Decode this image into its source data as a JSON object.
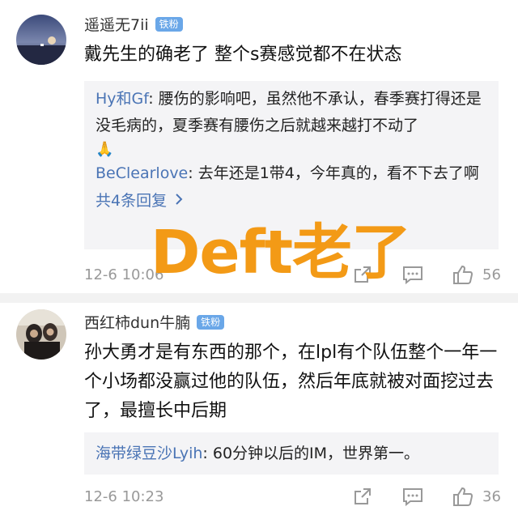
{
  "comments": [
    {
      "username": "遥遥无7ii",
      "badge": "铁粉",
      "text": "戴先生的确老了 整个s赛感觉都不在状态",
      "replies": [
        {
          "name": "Hy和Gf",
          "text": "腰伤的影响吧，虽然他不承认，春季赛打得还是没毛病的，夏季赛有腰伤之后就越来越打不动了"
        },
        {
          "name": "BeClearlove",
          "text": "去年还是1带4，今年真的，看不下去了啊"
        }
      ],
      "more_replies": "共4条回复",
      "date": "12-6 10:06",
      "likes": "56"
    },
    {
      "username": "西红柿dun牛腩",
      "badge": "铁粉",
      "text": "孙大勇才是有东西的那个，在lpl有个队伍整个一年一个小场都没赢过他的队伍，然后年底就被对面挖过去了，最擅长中后期",
      "replies": [
        {
          "name": "海带绿豆沙Lyih",
          "text": "60分钟以后的IM，世界第一。"
        }
      ],
      "date": "12-6 10:23",
      "likes": "36"
    }
  ],
  "overlay_caption": "Deft老了",
  "emoji": "🙏",
  "colors": {
    "accent": "#4a74b5",
    "badge": "#6aa7e8",
    "overlay": "#f39a16"
  }
}
